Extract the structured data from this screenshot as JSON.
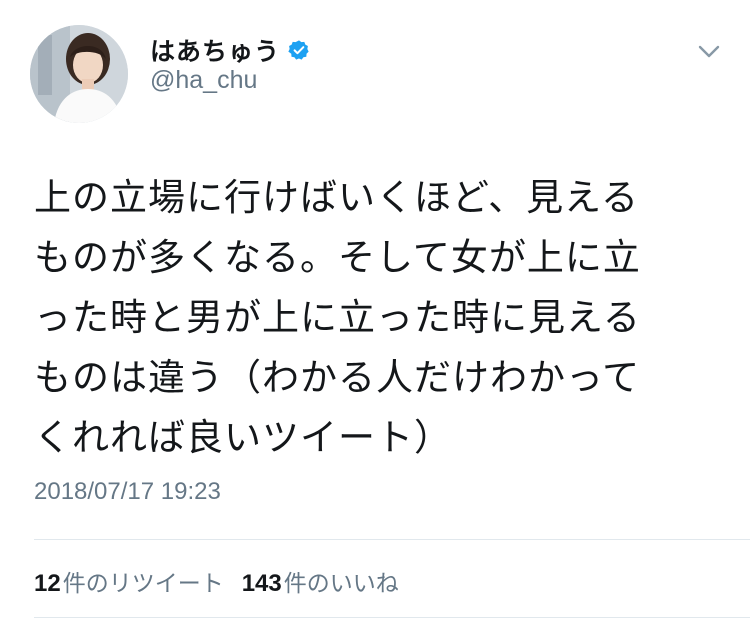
{
  "user": {
    "display_name": "はあちゅう",
    "handle": "@ha_chu",
    "verified": true
  },
  "tweet": {
    "text": "上の立場に行けばいくほど、見える\nものが多くなる。そして女が上に立\nった時と男が上に立った時に見える\nものは違う（わかる人だけわかって\nくれれば良いツイート）",
    "timestamp": "2018/07/17 19:23"
  },
  "stats": {
    "retweets": {
      "count": "12",
      "label": "件のリツイート"
    },
    "likes": {
      "count": "143",
      "label": "件のいいね"
    }
  },
  "icons": {
    "verified": "verified-badge-icon",
    "menu": "chevron-down-icon"
  },
  "colors": {
    "verified_blue": "#1da1f2",
    "secondary_text": "#657786",
    "primary_text": "#14171a",
    "divider": "#e1e8ed"
  }
}
